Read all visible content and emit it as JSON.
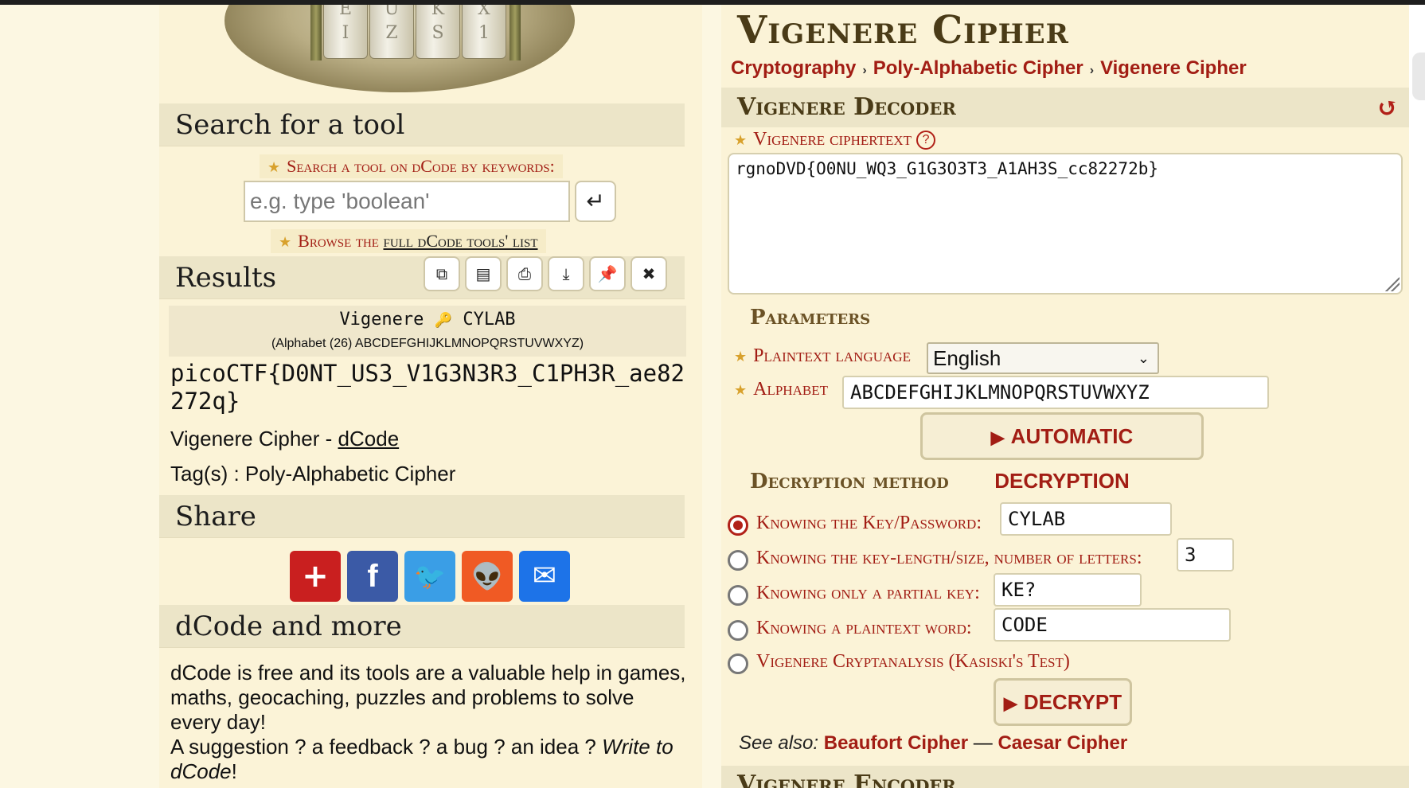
{
  "left": {
    "search_heading": "Search for a tool",
    "search_label": "Search a tool on dCode by keywords:",
    "search_placeholder": "e.g. type 'boolean'",
    "enter_icon": "↵",
    "browse_prefix": "Browse the",
    "browse_link": "full dCode tools' list",
    "results_heading": "Results",
    "toolbar_icons": [
      "copy-icon",
      "save-icon",
      "print-icon",
      "download-icon",
      "pin-icon",
      "close-icon"
    ],
    "result": {
      "method": "Vigenere",
      "key_icon": "🔑",
      "key": "CYLAB",
      "alphabet_note": "(Alphabet (26) ABCDEFGHIJKLMNOPQRSTUVWXYZ)",
      "plaintext": "picoCTF{D0NT_US3_V1G3N3R3_C1PH3R_ae82272q}",
      "source_prefix": "Vigenere Cipher - ",
      "source_link": "dCode",
      "tags": "Tag(s) : Poly-Alphabetic Cipher"
    },
    "share_heading": "Share",
    "share_buttons": [
      {
        "name": "add-this-icon",
        "glyph": "+",
        "color": "#c91f1f"
      },
      {
        "name": "facebook-icon",
        "glyph": "f",
        "color": "#3b5aa6"
      },
      {
        "name": "twitter-icon",
        "glyph": "🐦",
        "color": "#3a9ee6"
      },
      {
        "name": "reddit-icon",
        "glyph": "👽",
        "color": "#f05a24"
      },
      {
        "name": "email-icon",
        "glyph": "✉",
        "color": "#1d73e8"
      }
    ],
    "more_heading": "dCode and more",
    "more_text1": "dCode is free and its tools are a valuable help in games, maths, geocaching, puzzles and problems to solve every day!",
    "more_text2": "A suggestion ? a feedback ? a bug ? an idea ? ",
    "more_text2_italic": "Write to dCode",
    "more_text2_end": "!"
  },
  "right": {
    "title": "Vigenere Cipher",
    "breadcrumbs": [
      "Cryptography",
      "Poly-Alphabetic Cipher",
      "Vigenere Cipher"
    ],
    "decoder_heading": "Vigenere Decoder",
    "ciphertext_label": "Vigenere ciphertext",
    "ciphertext": "rgnoDVD{O0NU_WQ3_G1G3O3T3_A1AH3S_cc82272b}",
    "parameters_heading": "Parameters",
    "language_label": "Plaintext language",
    "language_value": "English",
    "alphabet_label": "Alphabet",
    "alphabet_value": "ABCDEFGHIJKLMNOPQRSTUVWXYZ",
    "auto_button": "AUTOMATIC DECRYPTION",
    "method_heading": "Decryption method",
    "methods": [
      {
        "label": "Knowing the Key/Password:",
        "value": "CYLAB",
        "selected": true
      },
      {
        "label": "Knowing the key-length/size, number of letters:",
        "value": "3",
        "selected": false
      },
      {
        "label": "Knowing only a partial key:",
        "value": "KE?",
        "selected": false
      },
      {
        "label": "Knowing a plaintext word:",
        "value": "CODE",
        "selected": false
      },
      {
        "label": "Vigenere Cryptanalysis (Kasiski's Test)",
        "value": "",
        "selected": false
      }
    ],
    "decrypt_button": "DECRYPT",
    "see_also_label": "See also:",
    "see_also_links": [
      "Beaufort Cipher",
      "Caesar Cipher"
    ],
    "see_also_sep": "—",
    "encoder_heading": "Vigenere Encoder"
  }
}
